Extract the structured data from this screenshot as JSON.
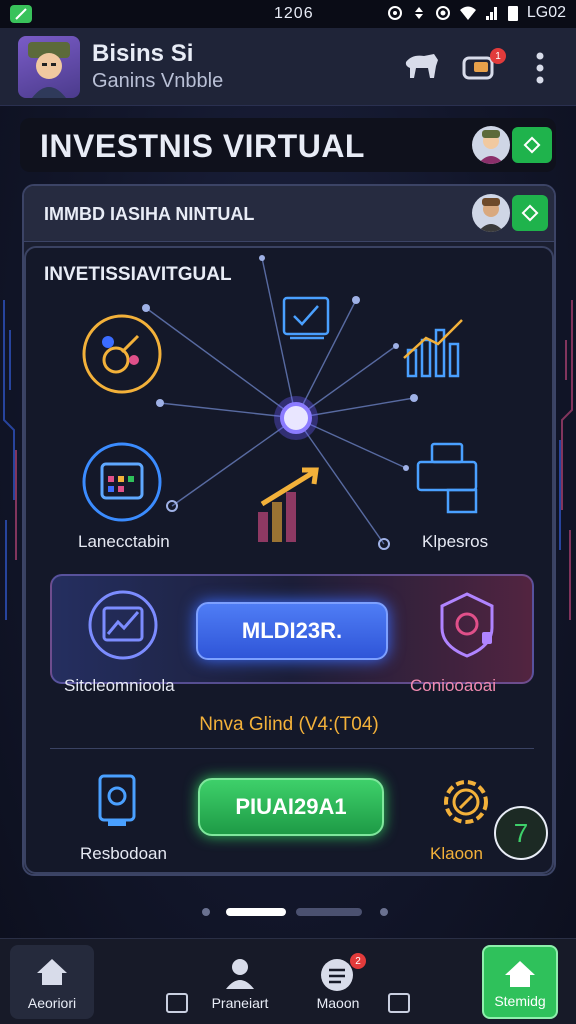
{
  "status_bar": {
    "time": "1206",
    "right_text": "LG02"
  },
  "header": {
    "title": "Bisins Si",
    "subtitle": "Ganins Vnbble",
    "badge_count": "1"
  },
  "banner": {
    "title": "INVESTNIS VIRTUAL"
  },
  "card": {
    "header_title": "IMMBD IASIHA NINTUAL",
    "inner_title": "INVETISSIAVITGUAL"
  },
  "network": {
    "label_left": "Lanecctabin",
    "label_right": "Klpesros"
  },
  "panel": {
    "button_label": "MLDI23R.",
    "label_left": "Sitcleomnioola",
    "label_right": "Coniooaoai"
  },
  "status_line": "Nnva Glind (V4:(T04)",
  "action": {
    "button_label": "PIUAI29A1",
    "label_left": "Resbodoan",
    "label_right": "Klaoon",
    "fab_label": "7"
  },
  "bottom_nav": {
    "items": [
      "Aeoriori",
      "Praneiart",
      "Maoon",
      "Stemidg"
    ],
    "badge_count": "2"
  },
  "colors": {
    "accent_blue": "#3b6cff",
    "accent_green": "#2fc15b",
    "accent_orange": "#f3b13a",
    "accent_pink": "#e0508a"
  }
}
